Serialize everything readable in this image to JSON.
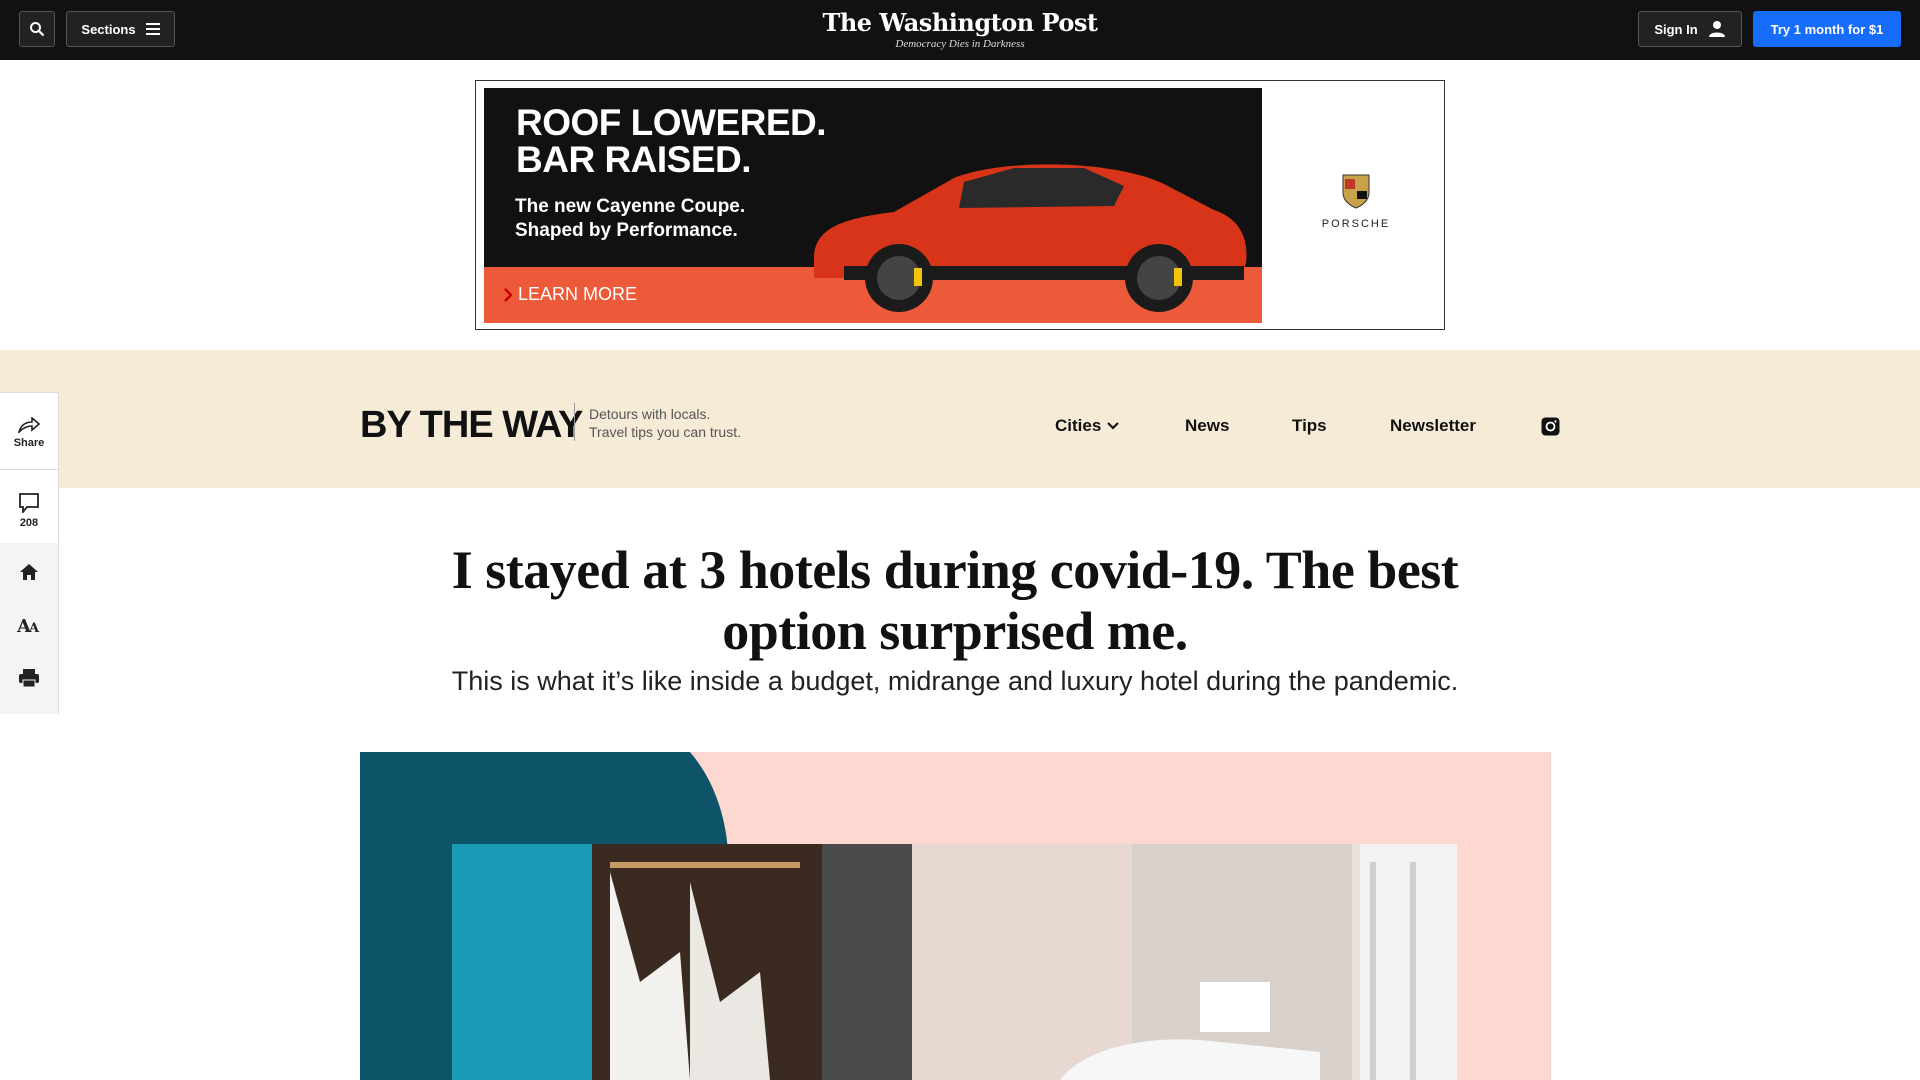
{
  "topbar": {
    "sections_label": "Sections",
    "logo": "The Washington Post",
    "tagline": "Democracy Dies in Darkness",
    "signin_label": "Sign In",
    "try_label": "Try 1 month for $1"
  },
  "ad": {
    "headline_line1": "ROOF LOWERED.",
    "headline_line2": "BAR RAISED.",
    "sub_line1": "The new Cayenne Coupe.",
    "sub_line2": "Shaped by Performance.",
    "cta": "LEARN MORE",
    "brand": "PORSCHE"
  },
  "section": {
    "logo": "BY THE WAY",
    "tag_line1": "Detours with locals.",
    "tag_line2": "Travel tips you can trust.",
    "nav": [
      "Cities",
      "News",
      "Tips",
      "Newsletter"
    ]
  },
  "rail": {
    "share_label": "Share",
    "comments_count": "208"
  },
  "article": {
    "headline": "I stayed at 3 hotels during covid-19. The best option surprised me.",
    "dek": "This is what it’s like inside a budget, midrange and luxury hotel during the pandemic."
  },
  "colors": {
    "topbar": "#111111",
    "accent_blue": "#166dfc",
    "section_band": "#f6ebd7",
    "hero_pink": "#fcd8d0",
    "hero_teal": "#0e5468"
  }
}
